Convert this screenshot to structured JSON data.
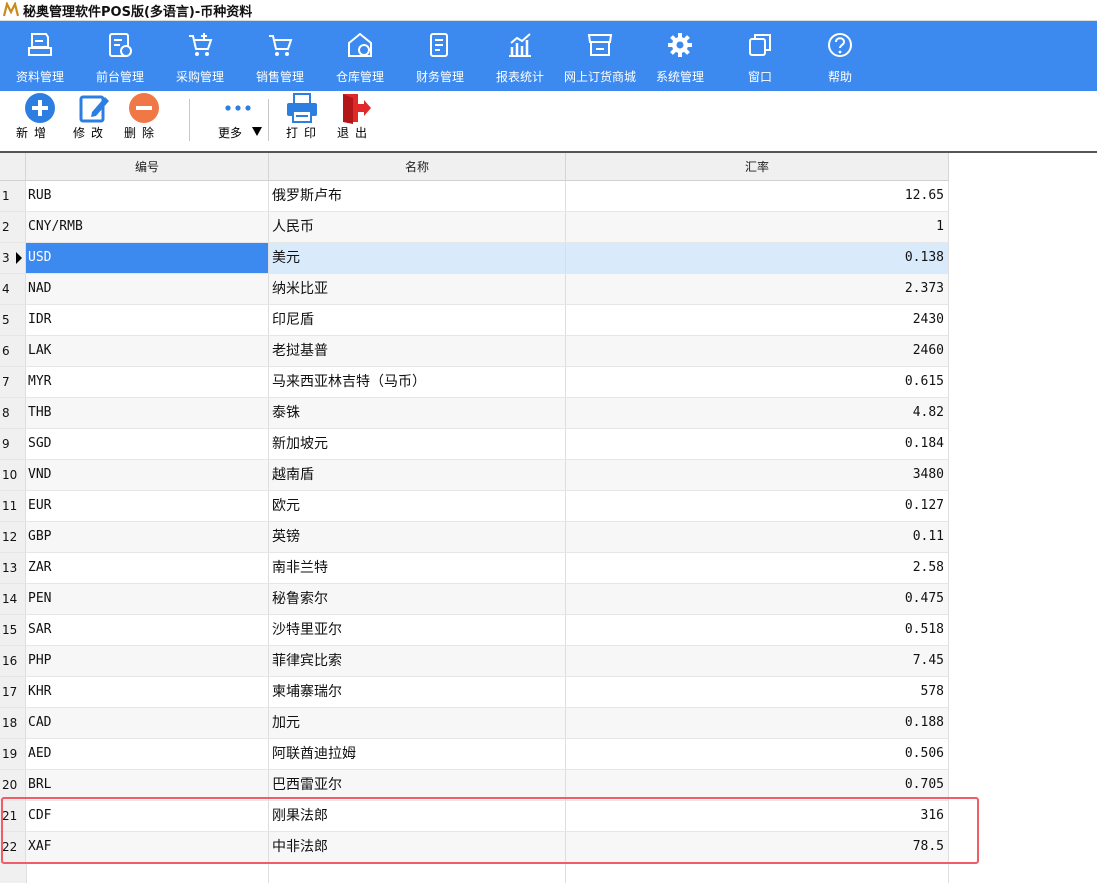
{
  "window": {
    "title": "秘奥管理软件POS版(多语言)-币种资料",
    "logo_text": "M"
  },
  "menu": [
    {
      "label": "资料管理",
      "icon": "data-management-icon"
    },
    {
      "label": "前台管理",
      "icon": "front-desk-icon"
    },
    {
      "label": "采购管理",
      "icon": "purchase-cart-icon"
    },
    {
      "label": "销售管理",
      "icon": "sales-cart-icon"
    },
    {
      "label": "仓库管理",
      "icon": "warehouse-icon"
    },
    {
      "label": "财务管理",
      "icon": "finance-icon"
    },
    {
      "label": "报表统计",
      "icon": "report-chart-icon"
    },
    {
      "label": "网上订货商城",
      "icon": "online-store-icon"
    },
    {
      "label": "系统管理",
      "icon": "gear-icon"
    },
    {
      "label": "窗口",
      "icon": "window-icon"
    },
    {
      "label": "帮助",
      "icon": "help-icon"
    }
  ],
  "toolbar": {
    "add_label": "新增",
    "edit_label": "修改",
    "delete_label": "删除",
    "more_label": "更多",
    "print_label": "打印",
    "exit_label": "退出"
  },
  "colors": {
    "menu_bg": "#3c8af0",
    "selected_row": "#d9ebfa",
    "selected_cell": "#3c8af0",
    "highlight_border": "#ef5d67"
  },
  "grid": {
    "columns": {
      "code": "编号",
      "name": "名称",
      "rate": "汇率"
    },
    "selected_row": 3,
    "rows": [
      {
        "n": "1",
        "code": "RUB",
        "name": "俄罗斯卢布",
        "rate": "12.65"
      },
      {
        "n": "2",
        "code": "CNY/RMB",
        "name": "人民币",
        "rate": "1"
      },
      {
        "n": "3",
        "code": "USD",
        "name": "美元",
        "rate": "0.138"
      },
      {
        "n": "4",
        "code": "NAD",
        "name": "纳米比亚",
        "rate": "2.373"
      },
      {
        "n": "5",
        "code": "IDR",
        "name": "印尼盾",
        "rate": "2430"
      },
      {
        "n": "6",
        "code": "LAK",
        "name": "老挝基普",
        "rate": "2460"
      },
      {
        "n": "7",
        "code": "MYR",
        "name": "马来西亚林吉特（马币）",
        "rate": "0.615"
      },
      {
        "n": "8",
        "code": "THB",
        "name": "泰铢",
        "rate": "4.82"
      },
      {
        "n": "9",
        "code": "SGD",
        "name": "新加坡元",
        "rate": "0.184"
      },
      {
        "n": "10",
        "code": "VND",
        "name": "越南盾",
        "rate": "3480"
      },
      {
        "n": "11",
        "code": "EUR",
        "name": "欧元",
        "rate": "0.127"
      },
      {
        "n": "12",
        "code": "GBP",
        "name": "英镑",
        "rate": "0.11"
      },
      {
        "n": "13",
        "code": "ZAR",
        "name": "南非兰特",
        "rate": "2.58"
      },
      {
        "n": "14",
        "code": "PEN",
        "name": "秘鲁索尔",
        "rate": "0.475"
      },
      {
        "n": "15",
        "code": "SAR",
        "name": "沙特里亚尔",
        "rate": "0.518"
      },
      {
        "n": "16",
        "code": "PHP",
        "name": "菲律宾比索",
        "rate": "7.45"
      },
      {
        "n": "17",
        "code": "KHR",
        "name": "柬埔寨瑞尔",
        "rate": "578"
      },
      {
        "n": "18",
        "code": "CAD",
        "name": "加元",
        "rate": "0.188"
      },
      {
        "n": "19",
        "code": "AED",
        "name": "阿联酋迪拉姆",
        "rate": "0.506"
      },
      {
        "n": "20",
        "code": "BRL",
        "name": "巴西雷亚尔",
        "rate": "0.705"
      },
      {
        "n": "21",
        "code": "CDF",
        "name": "刚果法郎",
        "rate": "316"
      },
      {
        "n": "22",
        "code": "XAF",
        "name": "中非法郎",
        "rate": "78.5"
      }
    ]
  }
}
